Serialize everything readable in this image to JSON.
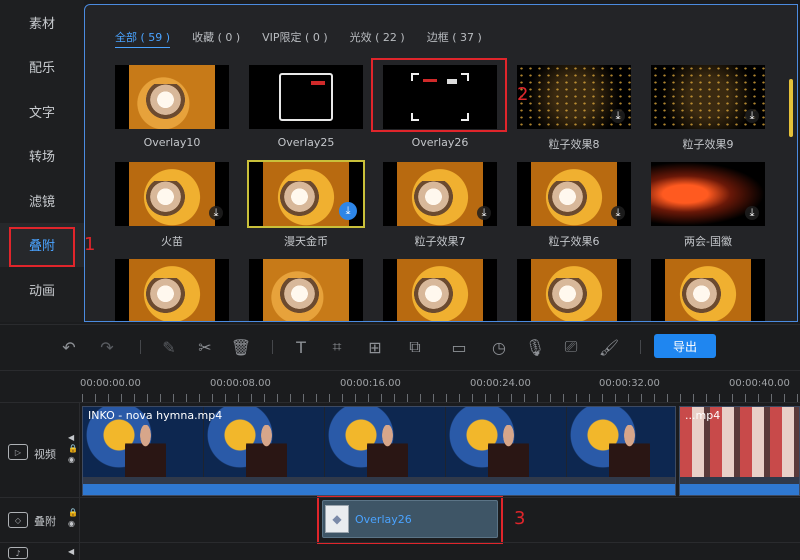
{
  "sidebar": {
    "items": [
      {
        "label": "素材"
      },
      {
        "label": "配乐"
      },
      {
        "label": "文字"
      },
      {
        "label": "转场"
      },
      {
        "label": "滤镜"
      },
      {
        "label": "叠附"
      },
      {
        "label": "动画"
      }
    ],
    "active_index": 5
  },
  "library": {
    "filters": [
      {
        "label": "全部 ( 59 )"
      },
      {
        "label": "收藏 ( 0 )"
      },
      {
        "label": "VIP限定 ( 0 )"
      },
      {
        "label": "光效 ( 22 )"
      },
      {
        "label": "边框 ( 37 )"
      }
    ],
    "items": [
      {
        "label": "Overlay10"
      },
      {
        "label": "Overlay25"
      },
      {
        "label": "Overlay26"
      },
      {
        "label": "粒子效果8"
      },
      {
        "label": "粒子效果9"
      },
      {
        "label": "火苗"
      },
      {
        "label": "漫天金币"
      },
      {
        "label": "粒子效果7"
      },
      {
        "label": "粒子效果6"
      },
      {
        "label": "两会-国徽"
      },
      {
        "label": ""
      },
      {
        "label": ""
      },
      {
        "label": ""
      },
      {
        "label": ""
      },
      {
        "label": ""
      }
    ]
  },
  "annotations": {
    "n1": "1",
    "n2": "2",
    "n3": "3"
  },
  "toolbar": {
    "icons": [
      "undo-icon",
      "redo-icon",
      "pen-icon",
      "scissors-icon",
      "delete-icon",
      "text-icon",
      "crop-icon",
      "add-frame-icon",
      "mosaic-icon",
      "zoom-icon",
      "speed-icon",
      "mic-icon",
      "screen-icon",
      "paint-icon"
    ],
    "export_label": "导出"
  },
  "ruler": {
    "labels": [
      "00:00:00.00",
      "00:00:08.00",
      "00:00:16.00",
      "00:00:24.00",
      "00:00:32.00",
      "00:00:40.00"
    ]
  },
  "tracks": {
    "video": {
      "name": "视频",
      "clip_title": "INKO - nova hymna.mp4",
      "clip2_title": "...mp4"
    },
    "overlay": {
      "name": "叠附",
      "clip_label": "Overlay26"
    }
  },
  "colors": {
    "accent": "#4aa3ff",
    "export_button": "#1f86f0",
    "callout": "#e0252b",
    "selection": "#c9c03a"
  }
}
